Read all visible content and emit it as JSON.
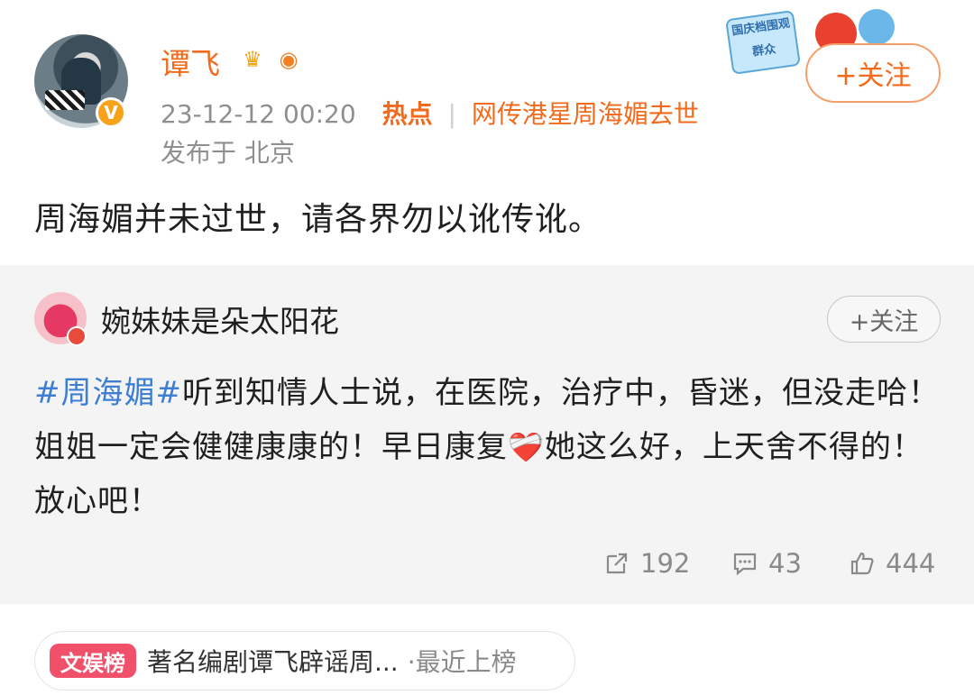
{
  "post": {
    "username": "谭飞",
    "timestamp": "23-12-12 00:20",
    "hot_label": "热点",
    "hot_topic": "网传港星周海媚去世",
    "location": "发布于 北京",
    "follow_label": "+关注",
    "text": "周海媚并未过世，请各界勿以讹传讹。",
    "deco_tag": "国庆档围观群众"
  },
  "repost": {
    "username": "婉妹妹是朵太阳花",
    "follow_label": "+关注",
    "hashtag": "#周海媚#",
    "text_part1": "听到知情人士说，在医院，治疗中，昏迷，但没走哈！姐姐一定会健健康康的！早日康复",
    "text_part2": "她这么好，上天舍不得的！放心吧！",
    "heart_emoji": "❤️‍🩹"
  },
  "stats": {
    "shares": "192",
    "comments": "43",
    "likes": "444"
  },
  "hotbar": {
    "tag": "文娱榜",
    "title": "著名编剧谭飞辟谣周...",
    "suffix": "·最近上榜"
  },
  "colors": {
    "accent": "#f26a1b",
    "hashtag": "#3d7ed2",
    "repost_bg": "#f4f4f4"
  }
}
